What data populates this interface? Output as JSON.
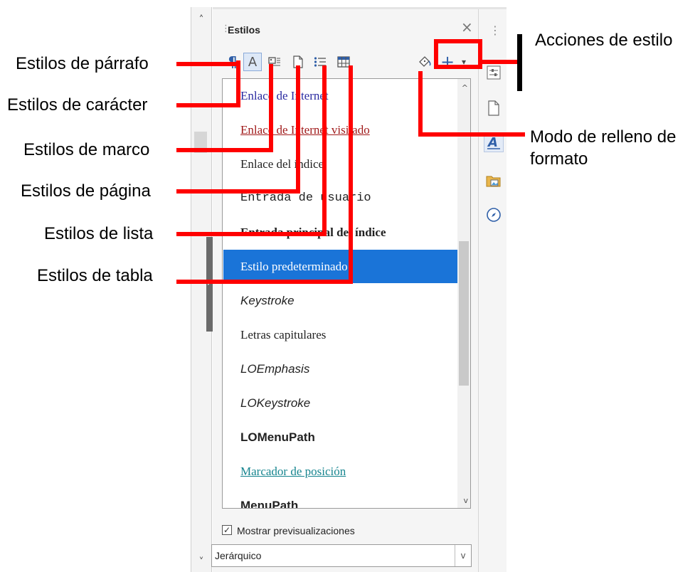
{
  "panel": {
    "title": "Estilos",
    "close_glyph": "×",
    "scroll_up_glyph": "^",
    "scroll_down_glyph": "v"
  },
  "toolbar": {
    "paragraph_glyph": "¶",
    "character_glyph": "A",
    "new_style_glyph": "+",
    "dropdown_glyph": "▾"
  },
  "styles_list": [
    {
      "label": "Enlace de Internet",
      "style": "link-blue"
    },
    {
      "label": "Enlace de Internet visitado",
      "style": "link-visited"
    },
    {
      "label": "Enlace del índice",
      "style": "serif"
    },
    {
      "label": "Entrada de usuario",
      "style": "mono"
    },
    {
      "label": "Entrada principal del índice",
      "style": "serif-bold"
    },
    {
      "label": "Estilo predeterminado",
      "style": "selected"
    },
    {
      "label": "Keystroke",
      "style": "sans-italic"
    },
    {
      "label": "Letras capitulares",
      "style": "serif"
    },
    {
      "label": "LOEmphasis",
      "style": "sans-italic"
    },
    {
      "label": "LOKeystroke",
      "style": "sans-italic"
    },
    {
      "label": "LOMenuPath",
      "style": "sans-bold"
    },
    {
      "label": "Marcador de posición",
      "style": "link-teal"
    },
    {
      "label": "MenuPath",
      "style": "sans-bold"
    }
  ],
  "preview": {
    "checked": true,
    "check_glyph": "✓",
    "label": "Mostrar previsualizaciones"
  },
  "filter": {
    "value": "Jerárquico",
    "dropdown_glyph": "v"
  },
  "annotations": {
    "paragraph": "Estilos de párrafo",
    "character": "Estilos de carácter",
    "frame": "Estilos de marco",
    "page": "Estilos de página",
    "list": "Estilos de lista",
    "table": "Estilos de tabla",
    "actions": "Acciones de estilo",
    "fill_format_line1": "Modo de relleno de",
    "fill_format_line2": "formato"
  },
  "colors": {
    "selection": "#1a74d8",
    "link_blue": "#2a2aa0",
    "link_visited": "#a01a1a",
    "link_teal": "#17858f",
    "annotation": "#ff0000"
  }
}
